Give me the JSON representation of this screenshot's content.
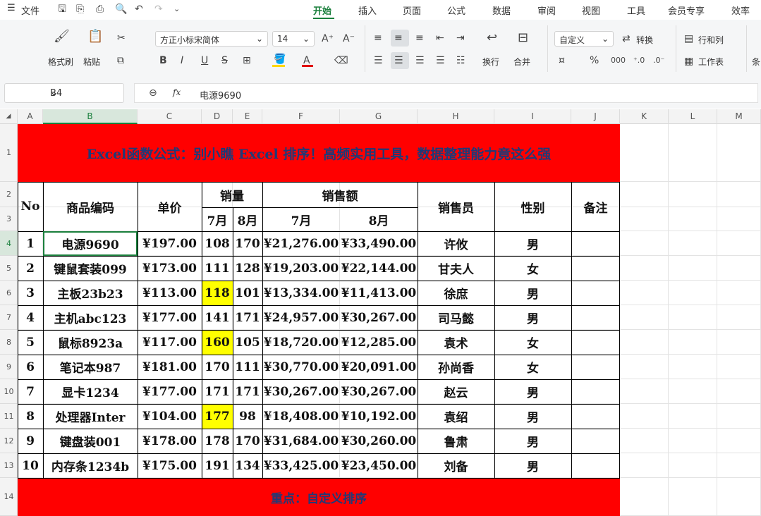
{
  "menu": {
    "hamburger": "☰",
    "file": "文件",
    "tabs": [
      "开始",
      "插入",
      "页面",
      "公式",
      "数据",
      "审阅",
      "视图",
      "工具",
      "会员专享",
      "效率"
    ],
    "active_tab": "开始"
  },
  "ribbon": {
    "format_painter": "格式刷",
    "paste": "粘贴",
    "font_name": "方正小标宋简体",
    "font_size": "14",
    "wrap": "换行",
    "merge": "合并",
    "number_format": "自定义",
    "convert": "转换",
    "row_col": "行和列",
    "worksheet": "工作表",
    "bold": "B",
    "italic": "I",
    "underline": "U",
    "strike": "S",
    "percent": "%",
    "cond": "条",
    "font_color": "#e00000",
    "fill_color": "#ffd800"
  },
  "formula_bar": {
    "cell_ref": "B4",
    "fx": "fx",
    "content": "电源9690"
  },
  "columns": [
    "A",
    "B",
    "C",
    "D",
    "E",
    "F",
    "G",
    "H",
    "I",
    "J",
    "K",
    "L",
    "M"
  ],
  "active_column": "B",
  "rows": [
    "1",
    "2",
    "3",
    "4",
    "5",
    "6",
    "7",
    "8",
    "9",
    "10",
    "11",
    "12",
    "13",
    "14"
  ],
  "active_row": "4",
  "sheet": {
    "title": "Excel函数公式：别小瞧 Excel 排序！高频实用工具，数据整理能力竟这么强",
    "footer": "重点：自定义排序",
    "banner_color": "#ff0000",
    "header": {
      "no": "No",
      "code": "商品编码",
      "price": "单价",
      "qty": "销量",
      "amount": "销售额",
      "month7": "7月",
      "month8": "8月",
      "seller": "销售员",
      "gender": "性别",
      "note": "备注"
    },
    "records": [
      {
        "no": "1",
        "code": "电源9690",
        "price": "¥197.00",
        "q7": "108",
        "q8": "170",
        "a7": "¥21,276.00",
        "a8": "¥33,490.00",
        "seller": "许攸",
        "gender": "男",
        "note": ""
      },
      {
        "no": "2",
        "code": "键鼠套装099",
        "price": "¥173.00",
        "q7": "111",
        "q8": "128",
        "a7": "¥19,203.00",
        "a8": "¥22,144.00",
        "seller": "甘夫人",
        "gender": "女",
        "note": ""
      },
      {
        "no": "3",
        "code": "主板23b23",
        "price": "¥113.00",
        "q7": "118",
        "q8": "101",
        "a7": "¥13,334.00",
        "a8": "¥11,413.00",
        "seller": "徐庶",
        "gender": "男",
        "note": ""
      },
      {
        "no": "4",
        "code": "主机abc123",
        "price": "¥177.00",
        "q7": "141",
        "q8": "171",
        "a7": "¥24,957.00",
        "a8": "¥30,267.00",
        "seller": "司马懿",
        "gender": "男",
        "note": ""
      },
      {
        "no": "5",
        "code": "鼠标8923a",
        "price": "¥117.00",
        "q7": "160",
        "q8": "105",
        "a7": "¥18,720.00",
        "a8": "¥12,285.00",
        "seller": "袁术",
        "gender": "女",
        "note": ""
      },
      {
        "no": "6",
        "code": "笔记本987",
        "price": "¥181.00",
        "q7": "170",
        "q8": "111",
        "a7": "¥30,770.00",
        "a8": "¥20,091.00",
        "seller": "孙尚香",
        "gender": "女",
        "note": ""
      },
      {
        "no": "7",
        "code": "显卡1234",
        "price": "¥177.00",
        "q7": "171",
        "q8": "171",
        "a7": "¥30,267.00",
        "a8": "¥30,267.00",
        "seller": "赵云",
        "gender": "男",
        "note": ""
      },
      {
        "no": "8",
        "code": "处理器Inter",
        "price": "¥104.00",
        "q7": "177",
        "q8": "98",
        "a7": "¥18,408.00",
        "a8": "¥10,192.00",
        "seller": "袁绍",
        "gender": "男",
        "note": ""
      },
      {
        "no": "9",
        "code": "键盘装001",
        "price": "¥178.00",
        "q7": "178",
        "q8": "170",
        "a7": "¥31,684.00",
        "a8": "¥30,260.00",
        "seller": "鲁肃",
        "gender": "男",
        "note": ""
      },
      {
        "no": "10",
        "code": "内存条1234b",
        "price": "¥175.00",
        "q7": "191",
        "q8": "134",
        "a7": "¥33,425.00",
        "a8": "¥23,450.00",
        "seller": "刘备",
        "gender": "男",
        "note": ""
      }
    ],
    "highlighted_q7_rows": [
      2,
      4,
      7
    ],
    "highlight_color": "#ffff00"
  }
}
